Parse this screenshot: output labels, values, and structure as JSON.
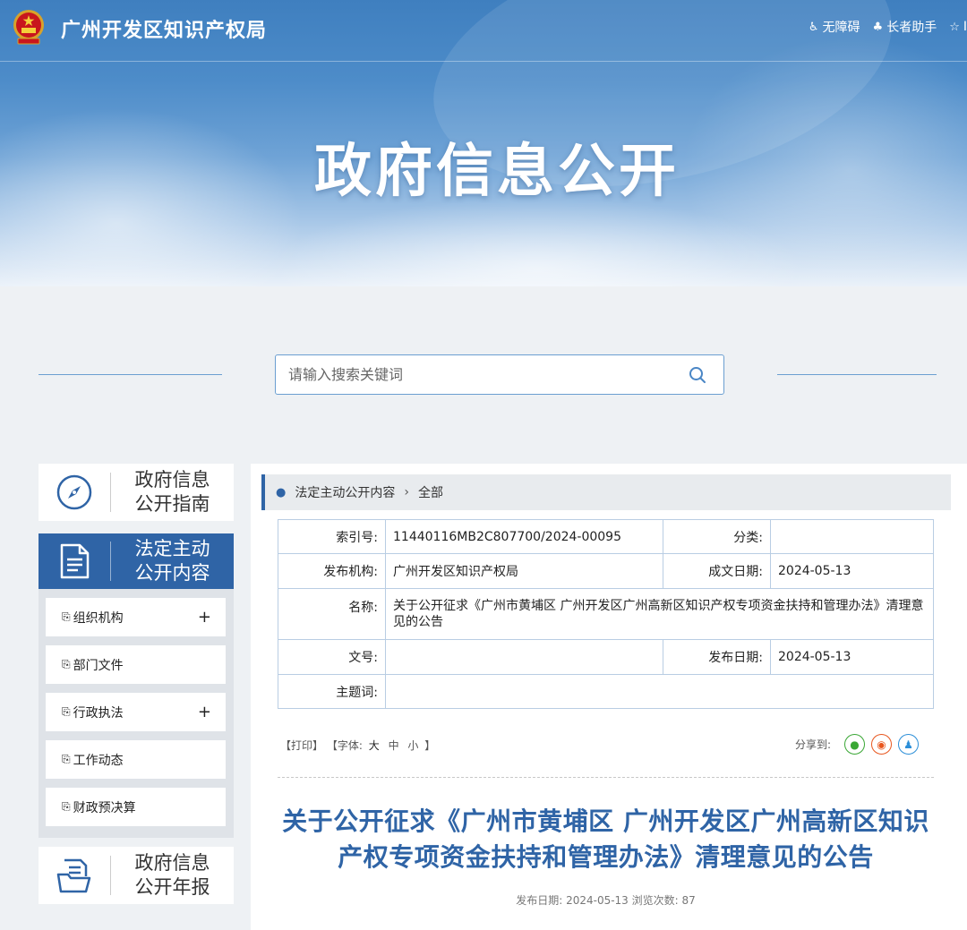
{
  "header": {
    "site_title": "广州开发区知识产权局",
    "tools": [
      {
        "icon": "accessibility-icon",
        "label": "无障碍"
      },
      {
        "icon": "elder-assist-icon",
        "label": "长者助手"
      },
      {
        "icon": "star-icon",
        "label": "I"
      }
    ],
    "hero_title": "政府信息公开"
  },
  "search": {
    "placeholder": "请输入搜索关键词"
  },
  "sidebar": {
    "guide": {
      "line1": "政府信息",
      "line2": "公开指南",
      "icon": "compass-icon"
    },
    "active": {
      "line1": "法定主动",
      "line2": "公开内容",
      "icon": "document-icon"
    },
    "items": [
      {
        "label": "组织机构",
        "has_plus": "+"
      },
      {
        "label": "部门文件",
        "has_plus": ""
      },
      {
        "label": "行政执法",
        "has_plus": "+"
      },
      {
        "label": "工作动态",
        "has_plus": ""
      },
      {
        "label": "财政预决算",
        "has_plus": ""
      }
    ],
    "report": {
      "line1": "政府信息",
      "line2": "公开年报",
      "icon": "report-icon"
    }
  },
  "breadcrumb": {
    "parent": "法定主动公开内容",
    "current": "全部"
  },
  "meta_table": {
    "index_label": "索引号:",
    "index_value": "11440116MB2C807700/2024-00095",
    "category_label": "分类:",
    "category_value": "",
    "publisher_label": "发布机构:",
    "publisher_value": "广州开发区知识产权局",
    "created_label": "成文日期:",
    "created_value": "2024-05-13",
    "name_label": "名称:",
    "name_value": "关于公开征求《广州市黄埔区 广州开发区广州高新区知识产权专项资金扶持和管理办法》清理意见的公告",
    "docno_label": "文号:",
    "docno_value": "",
    "published_label": "发布日期:",
    "published_value": "2024-05-13",
    "keywords_label": "主题词:",
    "keywords_value": ""
  },
  "actions": {
    "print": "【打印】",
    "font_prefix": "【字体:",
    "font_large": "大",
    "font_medium": "中",
    "font_small": "小",
    "font_suffix": "】",
    "share_label": "分享到:",
    "share_colors": {
      "wechat": "#3aa735",
      "weibo": "#e8571f",
      "qq": "#2d8fd8"
    }
  },
  "article": {
    "title": "关于公开征求《广州市黄埔区 广州开发区广州高新区知识产权专项资金扶持和管理办法》清理意见的公告",
    "meta": "发布日期:  2024-05-13  浏览次数:  87"
  }
}
